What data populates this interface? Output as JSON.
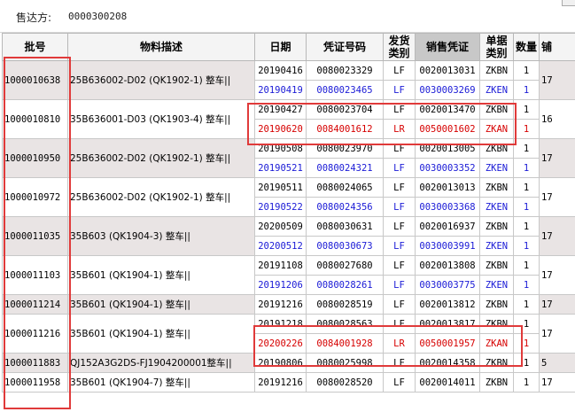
{
  "header": {
    "sold_to_label": "售达方:",
    "sold_to_value": "0000300208"
  },
  "columns": {
    "batch": "批号",
    "material": "物料描述",
    "date": "日期",
    "voucher": "凭证号码",
    "ship_type_l1": "发货",
    "ship_type_l2": "类别",
    "sales_voucher": "销售凭证",
    "doc_type_l1": "单据",
    "doc_type_l2": "类别",
    "qty": "数量",
    "extra": "铺"
  },
  "groups": [
    {
      "batch": "1000010638",
      "material": "25B636002-D02 (QK1902-1) 整车||",
      "extra": "17",
      "shade": true,
      "lines": [
        {
          "date": "20190416",
          "voucher": "0080023329",
          "ship": "LF",
          "sales": "0020013031",
          "doc": "ZKBN",
          "qty": "1",
          "color": "black"
        },
        {
          "date": "20190419",
          "voucher": "0080023465",
          "ship": "LF",
          "sales": "0030003269",
          "doc": "ZKEN",
          "qty": "1",
          "color": "blue"
        }
      ]
    },
    {
      "batch": "1000010810",
      "material": "35B636001-D03 (QK1903-4) 整车||",
      "extra": "16",
      "shade": false,
      "lines": [
        {
          "date": "20190427",
          "voucher": "0080023704",
          "ship": "LF",
          "sales": "0020013470",
          "doc": "ZKBN",
          "qty": "1",
          "color": "black"
        },
        {
          "date": "20190620",
          "voucher": "0084001612",
          "ship": "LR",
          "sales": "0050001602",
          "doc": "ZKAN",
          "qty": "1",
          "color": "red"
        }
      ]
    },
    {
      "batch": "1000010950",
      "material": "25B636002-D02 (QK1902-1) 整车||",
      "extra": "17",
      "shade": true,
      "lines": [
        {
          "date": "20190508",
          "voucher": "0080023970",
          "ship": "LF",
          "sales": "0020013005",
          "doc": "ZKBN",
          "qty": "1",
          "color": "black"
        },
        {
          "date": "20190521",
          "voucher": "0080024321",
          "ship": "LF",
          "sales": "0030003352",
          "doc": "ZKEN",
          "qty": "1",
          "color": "blue"
        }
      ]
    },
    {
      "batch": "1000010972",
      "material": "25B636002-D02 (QK1902-1) 整车||",
      "extra": "17",
      "shade": false,
      "lines": [
        {
          "date": "20190511",
          "voucher": "0080024065",
          "ship": "LF",
          "sales": "0020013013",
          "doc": "ZKBN",
          "qty": "1",
          "color": "black"
        },
        {
          "date": "20190522",
          "voucher": "0080024356",
          "ship": "LF",
          "sales": "0030003368",
          "doc": "ZKEN",
          "qty": "1",
          "color": "blue"
        }
      ]
    },
    {
      "batch": "1000011035",
      "material": "35B603 (QK1904-3) 整车||",
      "extra": "17",
      "shade": true,
      "lines": [
        {
          "date": "20200509",
          "voucher": "0080030631",
          "ship": "LF",
          "sales": "0020016937",
          "doc": "ZKBN",
          "qty": "1",
          "color": "black"
        },
        {
          "date": "20200512",
          "voucher": "0080030673",
          "ship": "LF",
          "sales": "0030003991",
          "doc": "ZKEN",
          "qty": "1",
          "color": "blue"
        }
      ]
    },
    {
      "batch": "1000011103",
      "material": "35B601 (QK1904-1) 整车||",
      "extra": "17",
      "shade": false,
      "lines": [
        {
          "date": "20191108",
          "voucher": "0080027680",
          "ship": "LF",
          "sales": "0020013808",
          "doc": "ZKBN",
          "qty": "1",
          "color": "black"
        },
        {
          "date": "20191206",
          "voucher": "0080028261",
          "ship": "LF",
          "sales": "0030003775",
          "doc": "ZKEN",
          "qty": "1",
          "color": "blue"
        }
      ]
    },
    {
      "batch": "1000011214",
      "material": "35B601 (QK1904-1) 整车||",
      "extra": "17",
      "shade": true,
      "lines": [
        {
          "date": "20191216",
          "voucher": "0080028519",
          "ship": "LF",
          "sales": "0020013812",
          "doc": "ZKBN",
          "qty": "1",
          "color": "black"
        }
      ]
    },
    {
      "batch": "1000011216",
      "material": "35B601 (QK1904-1) 整车||",
      "extra": "17",
      "shade": false,
      "lines": [
        {
          "date": "20191218",
          "voucher": "0080028563",
          "ship": "LF",
          "sales": "0020013817",
          "doc": "ZKBN",
          "qty": "1",
          "color": "black"
        },
        {
          "date": "20200226",
          "voucher": "0084001928",
          "ship": "LR",
          "sales": "0050001957",
          "doc": "ZKAN",
          "qty": "1",
          "color": "red"
        }
      ]
    },
    {
      "batch": "1000011883",
      "material": "QJ152A3G2DS-FJ1904200001整车||",
      "extra": "5",
      "shade": true,
      "lines": [
        {
          "date": "20190806",
          "voucher": "0080025998",
          "ship": "LF",
          "sales": "0020014358",
          "doc": "ZKBN",
          "qty": "1",
          "color": "black"
        }
      ]
    },
    {
      "batch": "1000011958",
      "material": "35B601 (QK1904-7) 整车||",
      "extra": "17",
      "shade": false,
      "lines": [
        {
          "date": "20191216",
          "voucher": "0080028520",
          "ship": "LF",
          "sales": "0020014011",
          "doc": "ZKBN",
          "qty": "1",
          "color": "black"
        }
      ]
    }
  ],
  "highlight_color": "#e03a3a"
}
